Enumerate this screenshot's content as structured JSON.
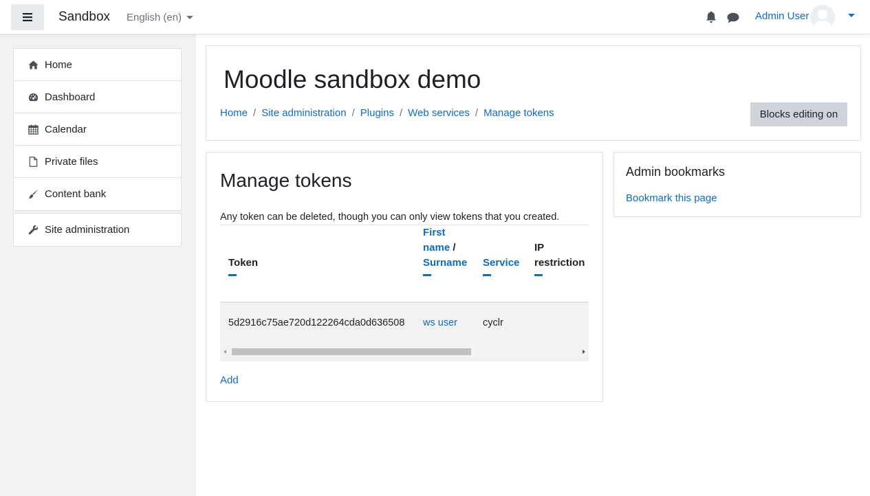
{
  "navbar": {
    "site_name": "Sandbox",
    "language": "English (en)",
    "user_name": "Admin User"
  },
  "drawer": {
    "items": [
      {
        "label": "Home",
        "icon": "home-icon"
      },
      {
        "label": "Dashboard",
        "icon": "dashboard-icon"
      },
      {
        "label": "Calendar",
        "icon": "calendar-icon"
      },
      {
        "label": "Private files",
        "icon": "file-icon"
      },
      {
        "label": "Content bank",
        "icon": "brush-icon"
      }
    ],
    "admin_item": {
      "label": "Site administration",
      "icon": "wrench-icon"
    }
  },
  "header": {
    "title": "Moodle sandbox demo",
    "breadcrumb": [
      "Home",
      "Site administration",
      "Plugins",
      "Web services",
      "Manage tokens"
    ],
    "blocks_button": "Blocks editing on"
  },
  "main": {
    "title": "Manage tokens",
    "intro": "Any token can be deleted, though you can only view tokens that you created.",
    "table": {
      "columns": {
        "token": "Token",
        "first_name": "First",
        "name_word": "name",
        "slash": " /",
        "surname": "Surname",
        "service": "Service",
        "ip_restriction_1": "IP",
        "ip_restriction_2": "restriction"
      },
      "rows": [
        {
          "token": "5d2916c75ae720d122264cda0d636508",
          "user": "ws user",
          "service": "cyclr"
        }
      ]
    },
    "add_link": "Add"
  },
  "bookmarks": {
    "title": "Admin bookmarks",
    "link": "Bookmark this page"
  },
  "colors": {
    "link": "#0f6cbf",
    "drawer_bg": "#f2f2f2",
    "button_bg": "#ced4da"
  }
}
